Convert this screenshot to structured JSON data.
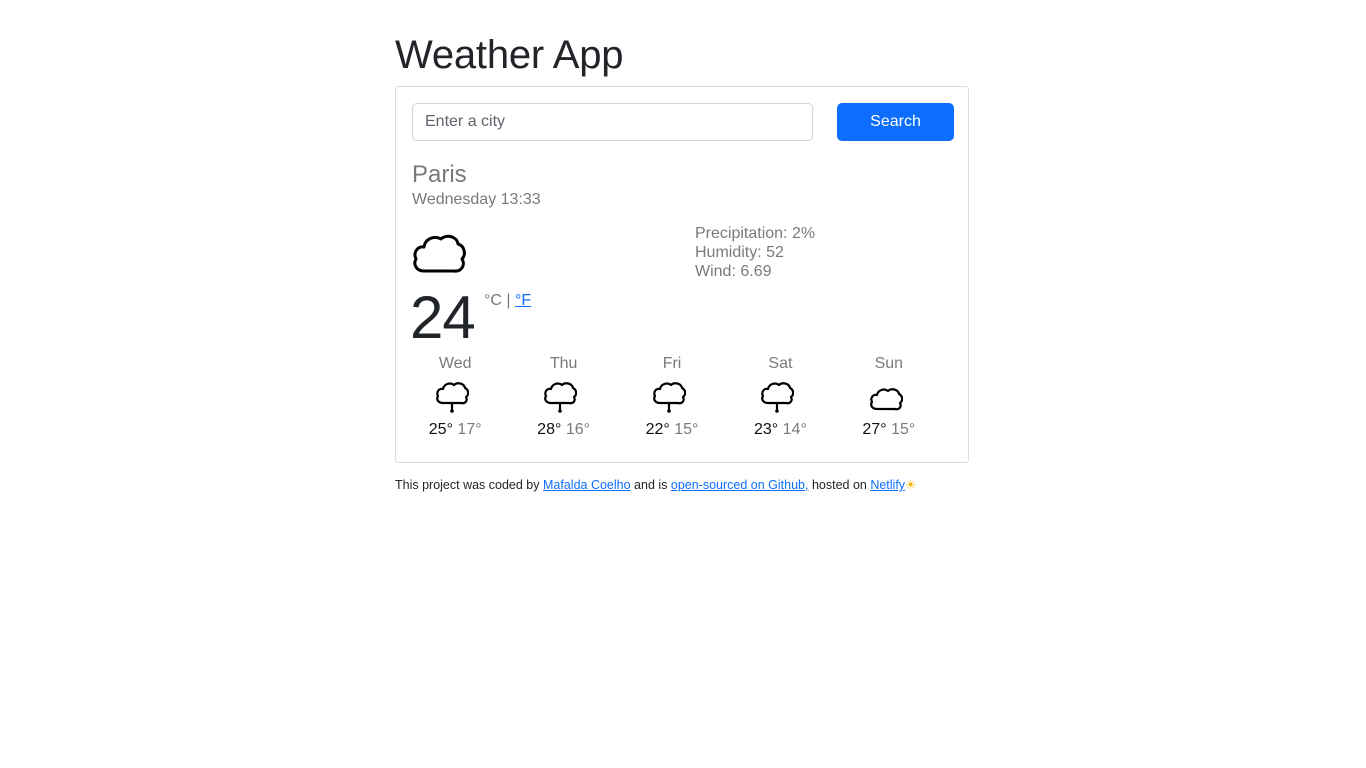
{
  "app": {
    "title": "Weather App"
  },
  "search": {
    "placeholder": "Enter a city",
    "button_label": "Search"
  },
  "current": {
    "city": "Paris",
    "datetime": "Wednesday 13:33",
    "icon": "cloud-icon",
    "temperature": "24",
    "unit_c": "°C |",
    "unit_f": "°F",
    "precipitation": "Precipitation: 2%",
    "humidity": "Humidity: 52",
    "wind": "Wind: 6.69"
  },
  "forecast": [
    {
      "day": "Wed",
      "icon": "rain-cloud-icon",
      "high": "25°",
      "low": "17°"
    },
    {
      "day": "Thu",
      "icon": "rain-cloud-icon",
      "high": "28°",
      "low": "16°"
    },
    {
      "day": "Fri",
      "icon": "rain-cloud-icon",
      "high": "22°",
      "low": "15°"
    },
    {
      "day": "Sat",
      "icon": "rain-cloud-icon",
      "high": "23°",
      "low": "14°"
    },
    {
      "day": "Sun",
      "icon": "cloud-icon",
      "high": "27°",
      "low": "15°"
    }
  ],
  "footer": {
    "text_1": "This project was coded by ",
    "author_link": "Mafalda Coelho",
    "text_2": " and is ",
    "github_link": "open-sourced on Github,",
    "text_3": " hosted on ",
    "netlify_link": "Netlify",
    "sun_glyph": "☀",
    "sun_icon": "sun-icon"
  },
  "colors": {
    "accent": "#0d6efd",
    "muted_text": "#7a7a7a",
    "border": "#dcdcdc"
  }
}
